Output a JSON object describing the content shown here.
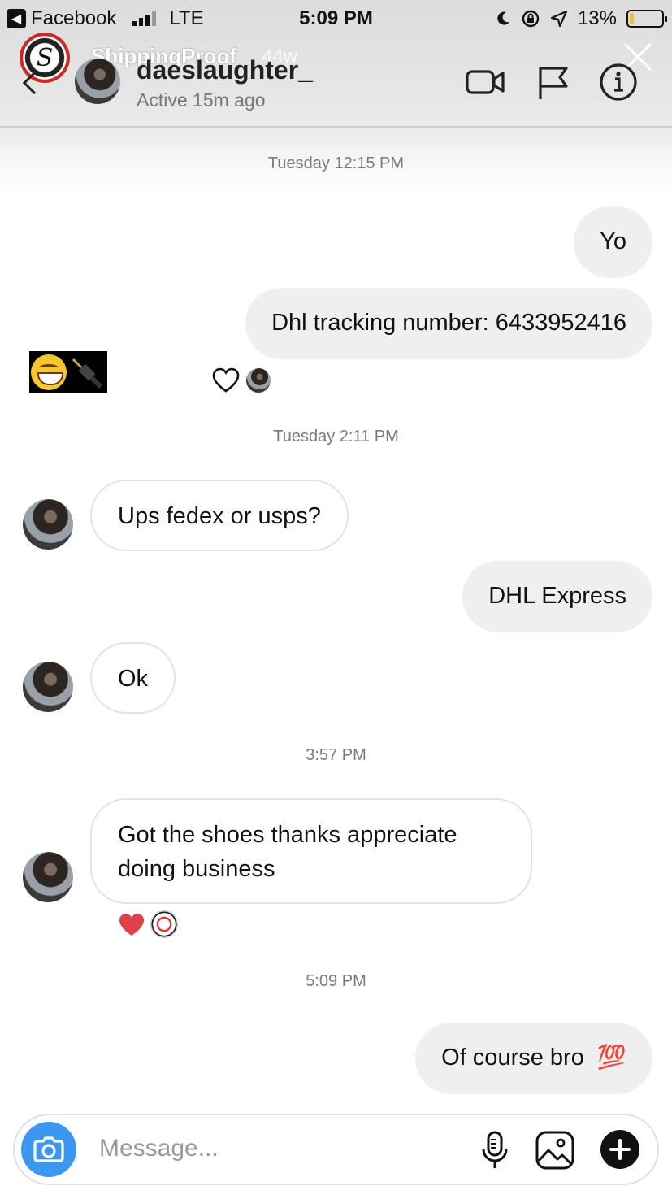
{
  "status_bar": {
    "back_app": "Facebook",
    "network": "LTE",
    "time": "5:09 PM",
    "battery": "13%",
    "battery_level": 0.13
  },
  "story_overlay": {
    "account": "ShippingProof",
    "age": "44w"
  },
  "header": {
    "username": "daeslaughter_",
    "status": "Active 15m ago"
  },
  "messages": {
    "ts1": "Tuesday 12:15 PM",
    "m1": "Yo",
    "m2": "Dhl tracking number: 6433952416",
    "ts2": "Tuesday 2:11 PM",
    "m3": "Ups fedex or usps?",
    "m4": "DHL Express",
    "m5": "Ok",
    "ts3": "3:57 PM",
    "m6": "Got the shoes thanks appreciate doing business",
    "ts4": "5:09 PM",
    "m7": "Of course bro",
    "m7_emoji": "💯"
  },
  "composer": {
    "placeholder": "Message..."
  },
  "colors": {
    "camera_button": "#3b97f0",
    "heart_red": "#e0404a",
    "bubble_me": "#efefef"
  }
}
